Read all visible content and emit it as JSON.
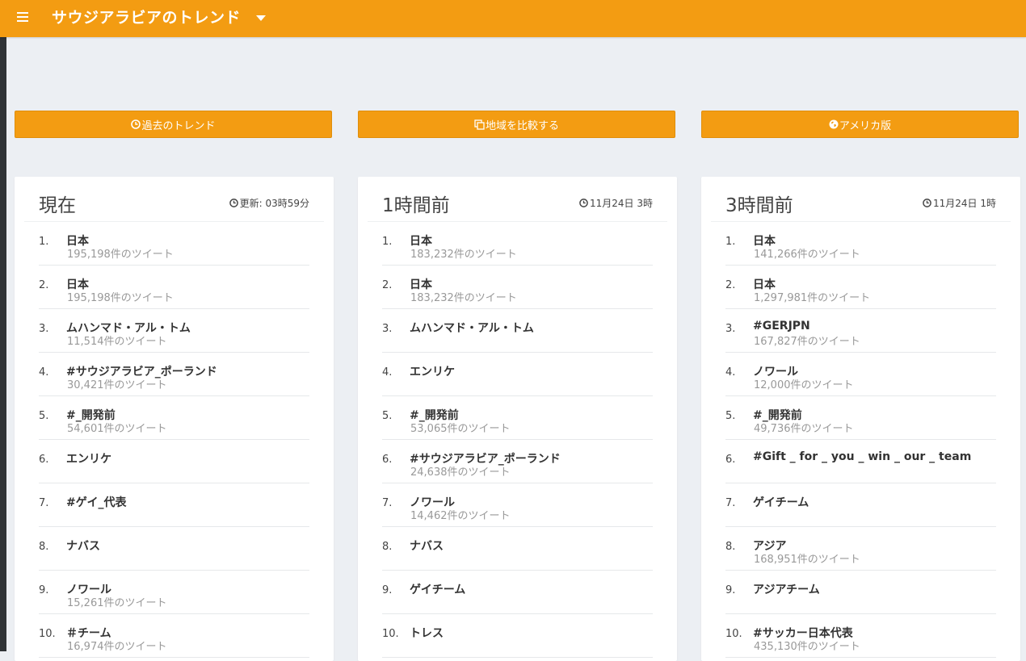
{
  "header": {
    "title": "サウジアラビアのトレンド"
  },
  "actions": [
    {
      "label": "過去のトレンド",
      "icon": "clock-icon"
    },
    {
      "label": "地域を比較する",
      "icon": "copy-icon"
    },
    {
      "label": "アメリカ版",
      "icon": "globe-icon"
    }
  ],
  "panels": [
    {
      "title": "現在",
      "time": "更新: 03時59分",
      "trends": [
        {
          "rank": "1.",
          "name": "日本",
          "count": "195,198件のツイート"
        },
        {
          "rank": "2.",
          "name": "日本",
          "count": "195,198件のツイート"
        },
        {
          "rank": "3.",
          "name": "ムハンマド・アル・トム",
          "count": "11,514件のツイート"
        },
        {
          "rank": "4.",
          "name": "#サウジアラビア_ポーランド",
          "count": "30,421件のツイート"
        },
        {
          "rank": "5.",
          "name": "#_開発前",
          "count": "54,601件のツイート"
        },
        {
          "rank": "6.",
          "name": "エンリケ",
          "count": ""
        },
        {
          "rank": "7.",
          "name": "#ゲイ_代表",
          "count": ""
        },
        {
          "rank": "8.",
          "name": "ナバス",
          "count": ""
        },
        {
          "rank": "9.",
          "name": "ノワール",
          "count": "15,261件のツイート"
        },
        {
          "rank": "10.",
          "name": "＃チーム",
          "count": "16,974件のツイート"
        }
      ]
    },
    {
      "title": "1時間前",
      "time": "11月24日 3時",
      "trends": [
        {
          "rank": "1.",
          "name": "日本",
          "count": "183,232件のツイート"
        },
        {
          "rank": "2.",
          "name": "日本",
          "count": "183,232件のツイート"
        },
        {
          "rank": "3.",
          "name": "ムハンマド・アル・トム",
          "count": ""
        },
        {
          "rank": "4.",
          "name": "エンリケ",
          "count": ""
        },
        {
          "rank": "5.",
          "name": "#_開発前",
          "count": "53,065件のツイート"
        },
        {
          "rank": "6.",
          "name": "#サウジアラビア_ポーランド",
          "count": "24,638件のツイート"
        },
        {
          "rank": "7.",
          "name": "ノワール",
          "count": "14,462件のツイート"
        },
        {
          "rank": "8.",
          "name": "ナバス",
          "count": ""
        },
        {
          "rank": "9.",
          "name": "ゲイチーム",
          "count": ""
        },
        {
          "rank": "10.",
          "name": "トレス",
          "count": ""
        }
      ]
    },
    {
      "title": "3時間前",
      "time": "11月24日 1時",
      "trends": [
        {
          "rank": "1.",
          "name": "日本",
          "count": "141,266件のツイート"
        },
        {
          "rank": "2.",
          "name": "日本",
          "count": "1,297,981件のツイート"
        },
        {
          "rank": "3.",
          "name": "#GERJPN",
          "count": "167,827件のツイート"
        },
        {
          "rank": "4.",
          "name": "ノワール",
          "count": "12,000件のツイート"
        },
        {
          "rank": "5.",
          "name": "#_開発前",
          "count": "49,736件のツイート"
        },
        {
          "rank": "6.",
          "name": "#Gift _ for _ you _ win _ our _ team",
          "count": ""
        },
        {
          "rank": "7.",
          "name": "ゲイチーム",
          "count": ""
        },
        {
          "rank": "8.",
          "name": "アジア",
          "count": "168,951件のツイート"
        },
        {
          "rank": "9.",
          "name": "アジアチーム",
          "count": ""
        },
        {
          "rank": "10.",
          "name": "#サッカー日本代表",
          "count": "435,130件のツイート"
        }
      ]
    }
  ]
}
